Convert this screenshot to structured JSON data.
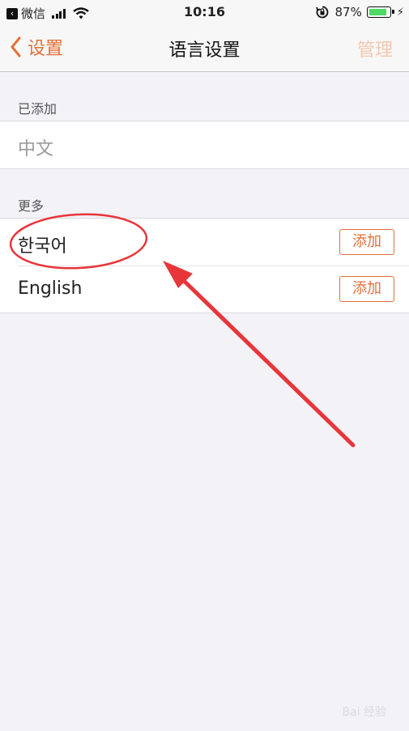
{
  "status_bar": {
    "back_app": "微信",
    "time": "10:16",
    "battery_percent": "87%",
    "battery_level": 0.87
  },
  "nav": {
    "back_label": "设置",
    "title": "语言设置",
    "manage_label": "管理"
  },
  "sections": {
    "added": {
      "header": "已添加",
      "items": [
        {
          "label": "中文"
        }
      ]
    },
    "more": {
      "header": "更多",
      "items": [
        {
          "label": "한국어",
          "action": "添加"
        },
        {
          "label": "English",
          "action": "添加"
        }
      ]
    }
  },
  "colors": {
    "accent": "#e2713a",
    "accent_disabled": "#f5c7ae",
    "annotation": "#e8353a",
    "battery": "#4cd964"
  },
  "watermark": "Bai 经验"
}
